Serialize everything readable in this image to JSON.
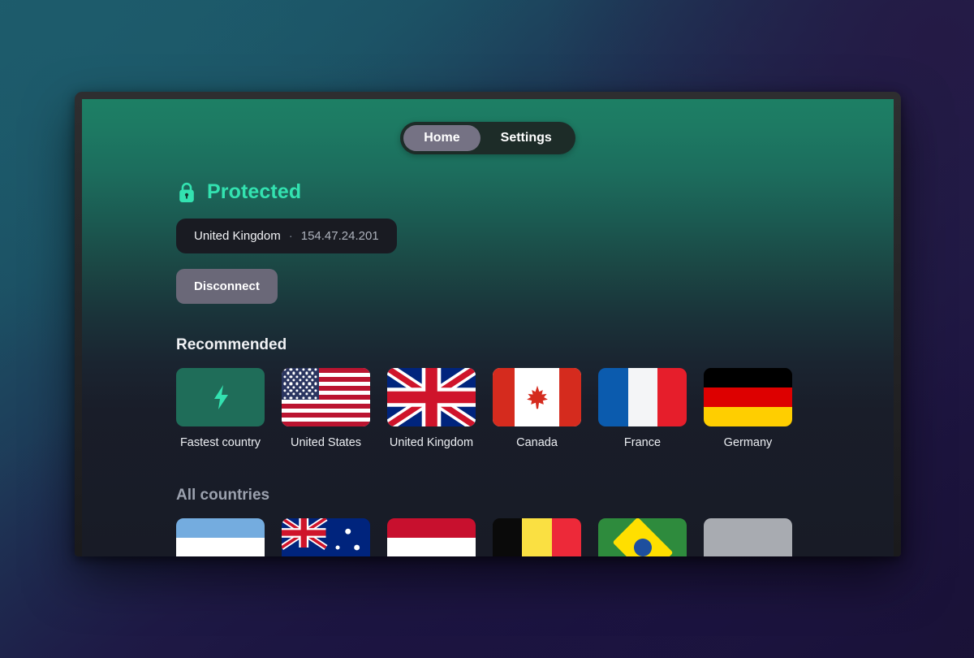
{
  "window": {
    "device": "tv-screen"
  },
  "tabs": {
    "items": [
      {
        "label": "Home",
        "active": true
      },
      {
        "label": "Settings",
        "active": false
      }
    ]
  },
  "status": {
    "icon": "lock-closed-icon",
    "label": "Protected",
    "accent_color": "#33e2b0"
  },
  "connection": {
    "country": "United Kingdom",
    "separator": "·",
    "ip_address": "154.47.24.201"
  },
  "actions": {
    "disconnect_label": "Disconnect"
  },
  "sections": {
    "recommended_title": "Recommended",
    "all_countries_title": "All countries"
  },
  "recommended": [
    {
      "label": "Fastest country",
      "flag": "fastest"
    },
    {
      "label": "United States",
      "flag": "us"
    },
    {
      "label": "United Kingdom",
      "flag": "uk"
    },
    {
      "label": "Canada",
      "flag": "ca"
    },
    {
      "label": "France",
      "flag": "fr"
    },
    {
      "label": "Germany",
      "flag": "de"
    }
  ],
  "all_countries_visible": [
    {
      "flag": "ar"
    },
    {
      "flag": "au"
    },
    {
      "flag": "at"
    },
    {
      "flag": "be"
    },
    {
      "flag": "br"
    },
    {
      "flag": "gray"
    }
  ]
}
